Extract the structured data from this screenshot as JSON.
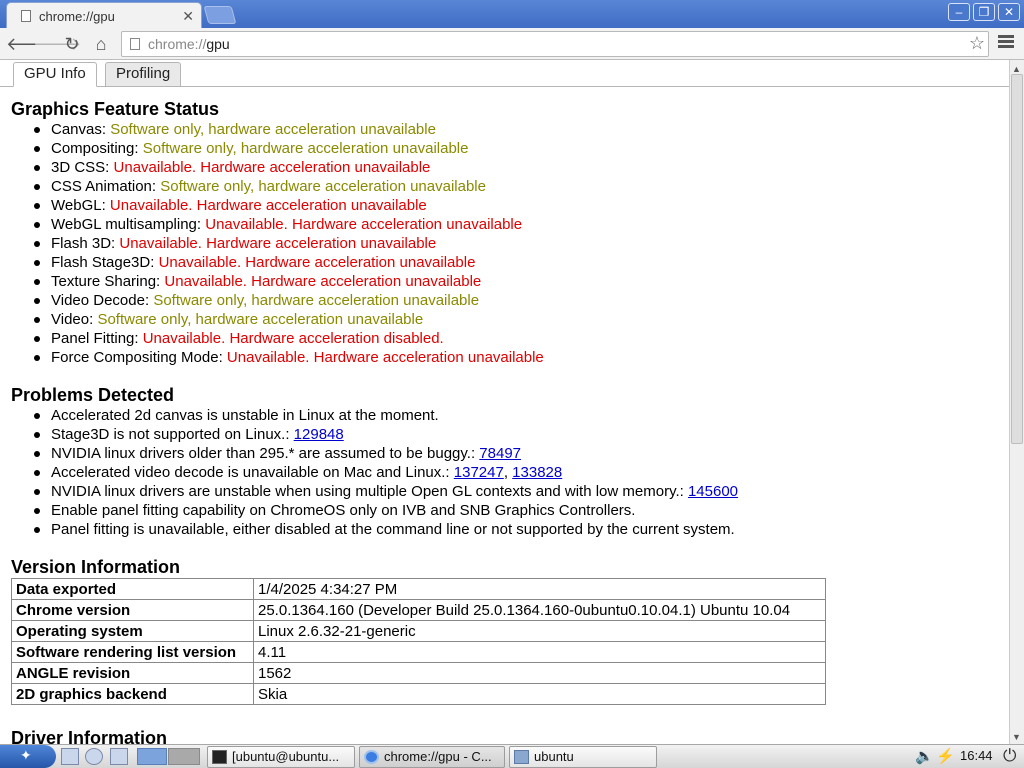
{
  "browser": {
    "tab_title": "chrome://gpu",
    "url_scheme": "chrome://",
    "url_host": "gpu"
  },
  "page_tabs": [
    {
      "label": "GPU Info"
    },
    {
      "label": "Profiling"
    }
  ],
  "feature_status": {
    "heading": "Graphics Feature Status",
    "items": [
      {
        "name": "Canvas:",
        "status": "Software only, hardware acceleration unavailable",
        "level": "warn"
      },
      {
        "name": "Compositing:",
        "status": "Software only, hardware acceleration unavailable",
        "level": "warn"
      },
      {
        "name": "3D CSS:",
        "status": "Unavailable. Hardware acceleration unavailable",
        "level": "bad"
      },
      {
        "name": "CSS Animation:",
        "status": "Software only, hardware acceleration unavailable",
        "level": "warn"
      },
      {
        "name": "WebGL:",
        "status": "Unavailable. Hardware acceleration unavailable",
        "level": "bad"
      },
      {
        "name": "WebGL multisampling:",
        "status": "Unavailable. Hardware acceleration unavailable",
        "level": "bad"
      },
      {
        "name": "Flash 3D:",
        "status": "Unavailable. Hardware acceleration unavailable",
        "level": "bad"
      },
      {
        "name": "Flash Stage3D:",
        "status": "Unavailable. Hardware acceleration unavailable",
        "level": "bad"
      },
      {
        "name": "Texture Sharing:",
        "status": "Unavailable. Hardware acceleration unavailable",
        "level": "bad"
      },
      {
        "name": "Video Decode:",
        "status": "Software only, hardware acceleration unavailable",
        "level": "warn"
      },
      {
        "name": "Video:",
        "status": "Software only, hardware acceleration unavailable",
        "level": "warn"
      },
      {
        "name": "Panel Fitting:",
        "status": "Unavailable. Hardware acceleration disabled.",
        "level": "bad"
      },
      {
        "name": "Force Compositing Mode:",
        "status": "Unavailable. Hardware acceleration unavailable",
        "level": "bad"
      }
    ]
  },
  "problems": {
    "heading": "Problems Detected",
    "items": [
      {
        "text": "Accelerated 2d canvas is unstable in Linux at the moment.",
        "bugs": []
      },
      {
        "text": "Stage3D is not supported on Linux.: ",
        "bugs": [
          "129848"
        ]
      },
      {
        "text": "NVIDIA linux drivers older than 295.* are assumed to be buggy.: ",
        "bugs": [
          "78497"
        ]
      },
      {
        "text": "Accelerated video decode is unavailable on Mac and Linux.: ",
        "bugs": [
          "137247",
          "133828"
        ]
      },
      {
        "text": "NVIDIA linux drivers are unstable when using multiple Open GL contexts and with low memory.: ",
        "bugs": [
          "145600"
        ]
      },
      {
        "text": "Enable panel fitting capability on ChromeOS only on IVB and SNB Graphics Controllers.",
        "bugs": []
      },
      {
        "text": "Panel fitting is unavailable, either disabled at the command line or not supported by the current system.",
        "bugs": []
      }
    ]
  },
  "version_info": {
    "heading": "Version Information",
    "rows": [
      {
        "key": "Data exported",
        "value": "1/4/2025 4:34:27 PM"
      },
      {
        "key": "Chrome version",
        "value": "25.0.1364.160 (Developer Build 25.0.1364.160-0ubuntu0.10.04.1) Ubuntu 10.04"
      },
      {
        "key": "Operating system",
        "value": "Linux 2.6.32-21-generic"
      },
      {
        "key": "Software rendering list version",
        "value": "4.11"
      },
      {
        "key": "ANGLE revision",
        "value": "1562"
      },
      {
        "key": "2D graphics backend",
        "value": "Skia"
      }
    ]
  },
  "driver_info": {
    "heading": "Driver Information"
  },
  "taskbar": {
    "tasks": [
      {
        "label": "[ubuntu@ubuntu..."
      },
      {
        "label": "chrome://gpu - C..."
      },
      {
        "label": "ubuntu"
      }
    ],
    "clock": "16:44"
  },
  "colors": {
    "warn": "#8a8a00",
    "bad": "#e00000",
    "link": "#0000cc",
    "title_bar": "#4a78cc"
  }
}
